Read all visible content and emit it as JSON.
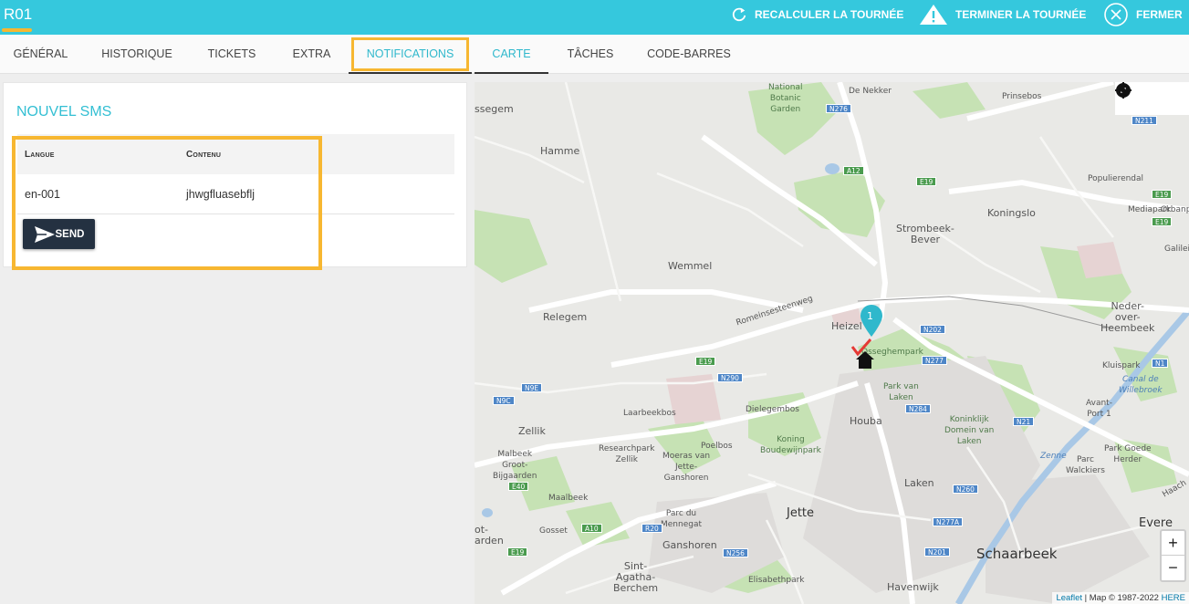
{
  "topbar": {
    "title": "R01",
    "actions": {
      "recalculate": "RECALCULER LA TOURNÉE",
      "finish": "TERMINER LA TOURNÉE",
      "close": "FERMER"
    },
    "accent_color": "#35c8dd"
  },
  "tabs": [
    {
      "label": "GÉNÉRAL"
    },
    {
      "label": "HISTORIQUE"
    },
    {
      "label": "TICKETS"
    },
    {
      "label": "EXTRA"
    },
    {
      "label": "NOTIFICATIONS"
    },
    {
      "label": "CARTE"
    },
    {
      "label": "TÂCHES"
    },
    {
      "label": "CODE-BARRES"
    }
  ],
  "sms_panel": {
    "heading": "NOUVEL SMS",
    "columns": {
      "language": "Langue",
      "content": "Contenu"
    },
    "rows": [
      {
        "language": "en-001",
        "content": "jhwgfluasebflj"
      }
    ],
    "send_label": "SEND"
  },
  "map": {
    "labels": {
      "bossegem": "ssegem",
      "national_botanic": "National\nBotanic\nGarden",
      "de_nekker": "De Nekker",
      "prinsebos": "Prinsebos",
      "hamme": "Hamme",
      "populierendal": "Populierendal",
      "koningslo": "Koningslo",
      "strombeek": "Strombeek-\nBever",
      "mediapark": "Mediapark",
      "orbanpa": "Orbanpa",
      "galilei": "Galilei",
      "wemmel": "Wemmel",
      "romeinse": "Romeinsesteenweg",
      "relegem": "Relegem",
      "neder": "Neder-\nover-\nHeembeek",
      "heizel": "Heizel",
      "osseghempark": "Osseghempark",
      "kluispark": "Kluispark",
      "canal": "Canal de\nWillebroek",
      "park_laken": "Park van\nLaken",
      "avant_port": "Avant-\nPort 1",
      "laarbeekbos": "Laarbeekbos",
      "dielegembos": "Dielegembos",
      "houba": "Houba",
      "koninklijk": "Koninklijk\nDomein van\nLaken",
      "zellik": "Zellik",
      "researchpark": "Researchpark\nZellik",
      "poelbos": "Poelbos",
      "koning_b": "Koning\nBoudewijnpark",
      "moeras": "Moeras van\nJette-\nGanshoren",
      "malbeek_groot": "Malbeek\nGroot-\nBijgaarden",
      "zenne": "Zenne",
      "park_walckiers": "Parc\nWalckiers",
      "park_goede": "Park Goede\nHerder",
      "laken": "Laken",
      "maalbeek": "Maalbeek",
      "parc_mennegat": "Parc du\nMennegat",
      "gosset": "Gosset",
      "jette": "Jette",
      "evere": "Evere",
      "ot_arden": "ot-\narden",
      "ganshoren": "Ganshoren",
      "sint_agatha": "Sint-\nAgatha-\nBerchem",
      "elisabethpark": "Elisabethpark",
      "schaarbeek": "Schaarbeek",
      "havenwijk": "Havenwijk",
      "haach": "Haach"
    },
    "shields": {
      "n276": "N276",
      "n211": "N211",
      "a12": "A12",
      "e19a": "E19",
      "e19b": "E19",
      "e19c": "E19",
      "n202": "N202",
      "n277": "N277",
      "n1": "N1",
      "e19d": "E19",
      "n290": "N290",
      "n9c": "N9C",
      "n9e": "N9E",
      "n284": "N284",
      "n21": "N21",
      "e40": "E40",
      "a10": "A10",
      "r20": "R20",
      "n260": "N260",
      "n277a": "N277A",
      "e19e": "E19",
      "n256": "N256",
      "n201": "N201"
    },
    "marker_number": "1",
    "attribution_leaflet": "Leaflet",
    "attribution_text": " | Map © 1987-2022 ",
    "attribution_here": "HERE",
    "zoom_in": "+",
    "zoom_out": "−"
  }
}
